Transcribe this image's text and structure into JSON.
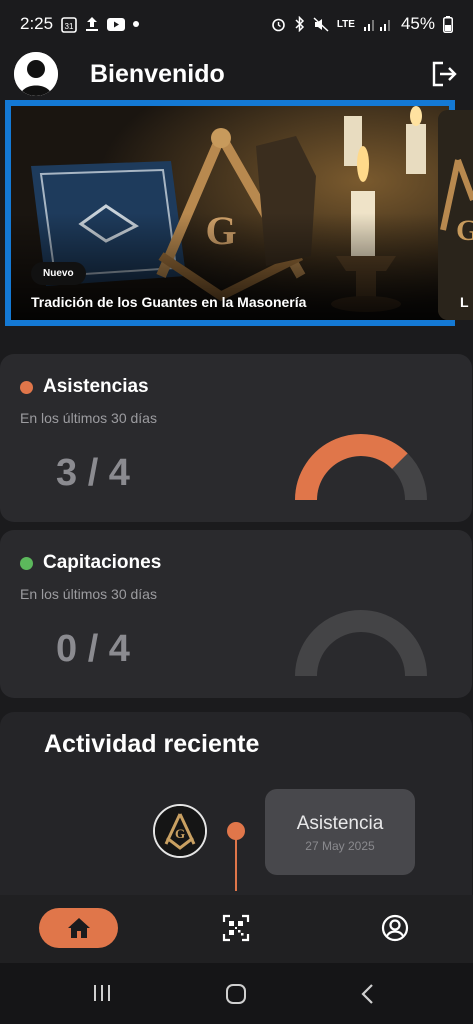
{
  "status_bar": {
    "time": "2:25",
    "calendar_day": "31",
    "network": "LTE",
    "battery": "45%"
  },
  "header": {
    "title": "Bienvenido"
  },
  "banner": {
    "badge": "Nuevo",
    "title": "Tradición de los Guantes en la Masonería",
    "next_peek_letter": "L"
  },
  "cards": {
    "asistencias": {
      "title": "Asistencias",
      "subtitle": "En los últimos 30 días",
      "count": "3 / 4",
      "value": 3,
      "total": 4,
      "color": "#e0764a"
    },
    "capitaciones": {
      "title": "Capitaciones",
      "subtitle": "En los últimos 30 días",
      "count": "0 / 4",
      "value": 0,
      "total": 4,
      "color": "#5cb85c"
    }
  },
  "activity": {
    "title": "Actividad reciente",
    "items": [
      {
        "type": "Asistencia",
        "date": "27 May 2025"
      }
    ]
  },
  "bottom_nav": {
    "items": [
      "home-icon",
      "qr-scan-icon",
      "profile-icon"
    ],
    "accent": "#e0764a"
  },
  "icons": [
    "calendar-icon",
    "upload-icon",
    "youtube-icon",
    "alarm-icon",
    "bluetooth-icon",
    "mute-icon",
    "signal-icon",
    "battery-icon",
    "logout-icon"
  ]
}
